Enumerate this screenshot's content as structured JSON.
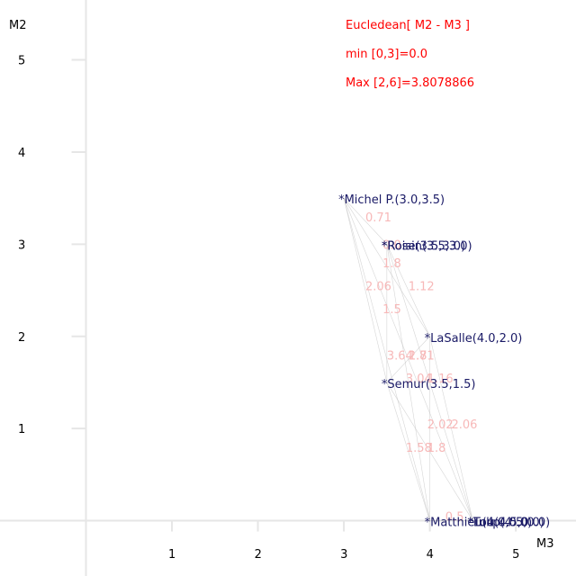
{
  "chart_data": {
    "type": "scatter",
    "xlabel": "M3",
    "ylabel": "M2",
    "xlim": [
      -1,
      5.7
    ],
    "ylim": [
      -0.6,
      5.65
    ],
    "x_ticks": [
      {
        "value": 1,
        "label": "1"
      },
      {
        "value": 2,
        "label": "2"
      },
      {
        "value": 3,
        "label": "3"
      },
      {
        "value": 4,
        "label": "4"
      },
      {
        "value": 5,
        "label": "5"
      }
    ],
    "y_ticks": [
      {
        "value": 1,
        "label": "1"
      },
      {
        "value": 2,
        "label": "2"
      },
      {
        "value": 3,
        "label": "3"
      },
      {
        "value": 4,
        "label": "4"
      },
      {
        "value": 5,
        "label": "5"
      }
    ],
    "points": [
      {
        "label": "*Michel P.(3.0,3.5)",
        "x": 3.0,
        "y": 3.5
      },
      {
        "label": "*Rose(3.5,3.0)",
        "x": 3.5,
        "y": 3.0
      },
      {
        "label": "*Roisin(3.5,3.0)",
        "x": 3.5,
        "y": 3.0
      },
      {
        "label": "*LaSalle(4.0,2.0)",
        "x": 4.0,
        "y": 2.0
      },
      {
        "label": "*Semur(3.5,1.5)",
        "x": 3.5,
        "y": 1.5
      },
      {
        "label": "*Matthieu(4.0,0.0)",
        "x": 4.0,
        "y": 0.0
      },
      {
        "label": "*Tulip(4.5,0.0)",
        "x": 4.5,
        "y": 0.0
      },
      {
        "label": "*Lou(4.5,0.0)",
        "x": 4.5,
        "y": 0.0
      }
    ],
    "edge_labels": [
      {
        "text": "0.71",
        "x": 3.25,
        "y": 3.25
      },
      {
        "text": "0.0",
        "x": 3.45,
        "y": 2.95
      },
      {
        "text": "1.8",
        "x": 3.45,
        "y": 2.75
      },
      {
        "text": "2.06",
        "x": 3.25,
        "y": 2.5
      },
      {
        "text": "1.12",
        "x": 3.75,
        "y": 2.5
      },
      {
        "text": "1.5",
        "x": 3.45,
        "y": 2.25
      },
      {
        "text": "3.64",
        "x": 3.5,
        "y": 1.75
      },
      {
        "text": "2.71",
        "x": 3.75,
        "y": 1.75
      },
      {
        "text": "1.8",
        "x": 3.75,
        "y": 1.75
      },
      {
        "text": "3.04",
        "x": 3.72,
        "y": 1.5
      },
      {
        "text": "1.16",
        "x": 3.97,
        "y": 1.5
      },
      {
        "text": "2.02",
        "x": 3.97,
        "y": 1.0
      },
      {
        "text": "2.06",
        "x": 4.25,
        "y": 1.0
      },
      {
        "text": "1.58",
        "x": 3.72,
        "y": 0.75
      },
      {
        "text": "1.8",
        "x": 3.97,
        "y": 0.75
      },
      {
        "text": "0.5",
        "x": 4.18,
        "y": 0.0
      }
    ]
  },
  "info": {
    "title": "Eucledean[ M2 - M3 ]",
    "min_text": "min [0,3]=0.0",
    "max_text": "Max [2,6]=3.8078866",
    "color": "#ff0000"
  },
  "colors": {
    "axis": "#e6e6e6",
    "edge": "#bbbbbb",
    "edge_label": "#f7b8b8",
    "point_label": "#1a1a66"
  }
}
